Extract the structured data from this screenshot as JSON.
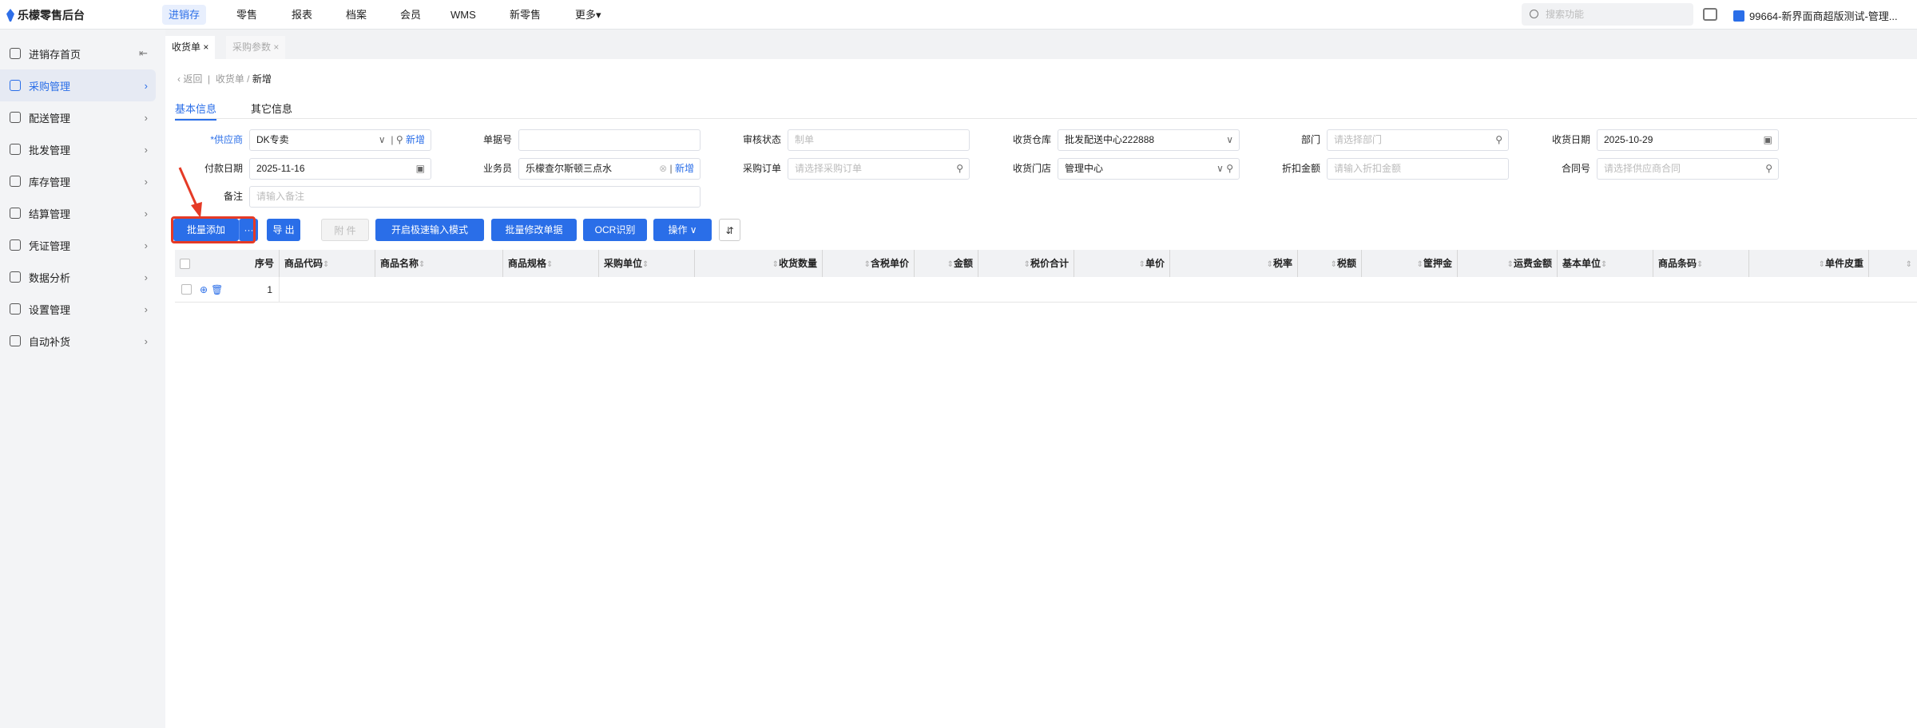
{
  "app": {
    "title": "乐檬零售后台",
    "search_placeholder": "搜索功能",
    "user": "99664-新界面商超版测试-管理..."
  },
  "topnav": [
    "进销存",
    "零售",
    "报表",
    "档案",
    "会员",
    "WMS",
    "新零售",
    "更多▾"
  ],
  "sidebar": [
    "进销存首页",
    "采购管理",
    "配送管理",
    "批发管理",
    "库存管理",
    "结算管理",
    "凭证管理",
    "数据分析",
    "设置管理",
    "自动补货"
  ],
  "tabs": [
    "收货单 ×",
    "采购参数 ×"
  ],
  "breadcrumb": {
    "back": "返回",
    "parent": "收货单",
    "sep": "/",
    "current": "新增"
  },
  "form_tabs": [
    "基本信息",
    "其它信息"
  ],
  "form": {
    "supplier_label": "*供应商",
    "supplier": "DK专卖",
    "add": "新增",
    "doc_no_label": "单据号",
    "audit_label": "审核状态",
    "audit_ph": "制单",
    "warehouse_label": "收货仓库",
    "warehouse": "批发配送中心222888",
    "dept_label": "部门",
    "dept_ph": "请选择部门",
    "recv_date_label": "收货日期",
    "recv_date": "2025-10-29",
    "pay_date_label": "付款日期",
    "pay_date": "2025-11-16",
    "clerk_label": "业务员",
    "clerk": "乐檬查尔斯顿三点水",
    "po_label": "采购订单",
    "po_ph": "请选择采购订单",
    "store_label": "收货门店",
    "store": "管理中心",
    "discount_label": "折扣金额",
    "discount_ph": "请输入折扣金额",
    "contract_label": "合同号",
    "contract_ph": "请选择供应商合同",
    "remark_label": "备注",
    "remark_ph": "请输入备注"
  },
  "toolbar": {
    "batch_add": "批量添加",
    "more": "···",
    "export": "导 出",
    "attach": "附 件",
    "fast": "开启极速输入模式",
    "batch_edit": "批量修改单据",
    "ocr": "OCR识别",
    "ops": "操作 ∨",
    "cols": "⇵"
  },
  "table": {
    "columns": [
      "序号",
      "商品代码",
      "商品名称",
      "商品规格",
      "采购单位",
      "收货数量",
      "含税单价",
      "金额",
      "税价合计",
      "单价",
      "税率",
      "税额",
      "筐押金",
      "运费金额",
      "基本单位",
      "商品条码",
      "单件皮重"
    ],
    "rows": [
      {
        "no": "1"
      }
    ]
  },
  "colors": {
    "accent": "#2a6ee8",
    "highlight": "#e53a26"
  }
}
